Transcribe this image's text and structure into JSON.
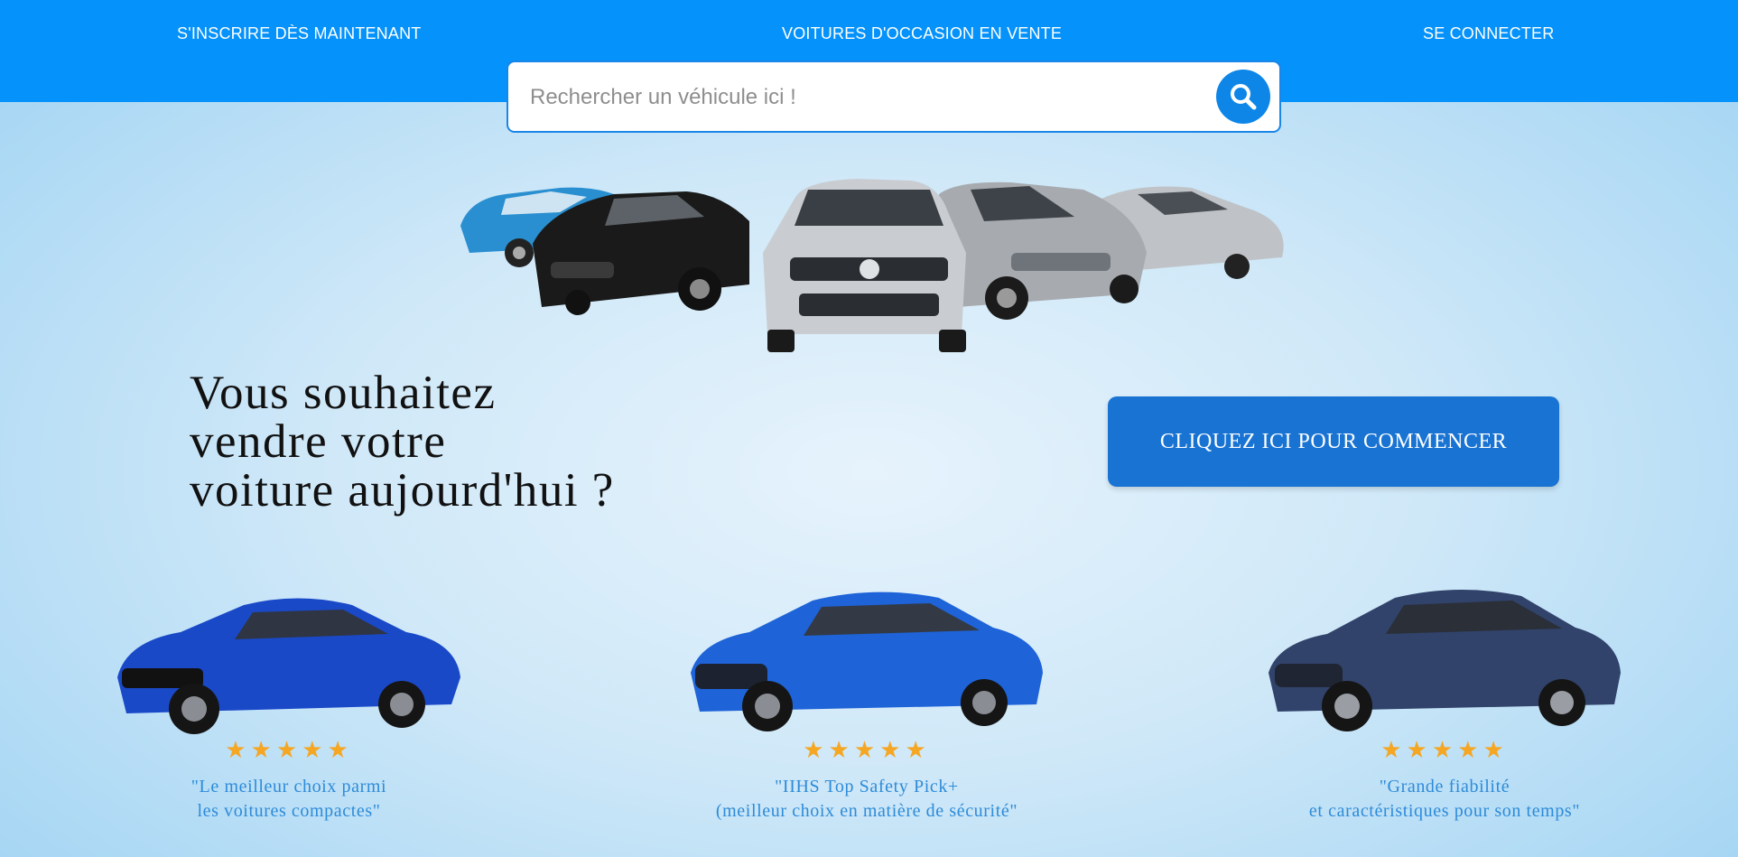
{
  "nav": {
    "signup": "S'INSCRIRE DÈS MAINTENANT",
    "used_cars": "VOITURES D'OCCASION EN VENTE",
    "login": "SE CONNECTER"
  },
  "search": {
    "placeholder": "Rechercher un véhicule ici !",
    "icon": "search-icon"
  },
  "hero": {
    "headline_lines": [
      "Vous souhaitez",
      "vendre votre",
      "voiture aujourd'hui ?"
    ],
    "cta_label": "CLIQUEZ ICI POUR COMMENCER"
  },
  "cards": [
    {
      "rating": 5,
      "stars": "★★★★★",
      "quote_lines": [
        "\"Le meilleur choix parmi",
        "les voitures compactes\""
      ],
      "car_color": "#1a49c8"
    },
    {
      "rating": 5,
      "stars": "★★★★★",
      "quote_lines": [
        "\"IIHS Top Safety Pick+",
        "(meilleur choix en matière de sécurité\""
      ],
      "car_color": "#1e63d8"
    },
    {
      "rating": 5,
      "stars": "★★★★★",
      "quote_lines": [
        "\"Grande fiabilité",
        "et caractéristiques pour son temps\""
      ],
      "car_color": "#31436b"
    }
  ],
  "colors": {
    "header": "#0592fb",
    "accent": "#1873d3",
    "star": "#f5a623",
    "quote": "#2e8bd8"
  }
}
